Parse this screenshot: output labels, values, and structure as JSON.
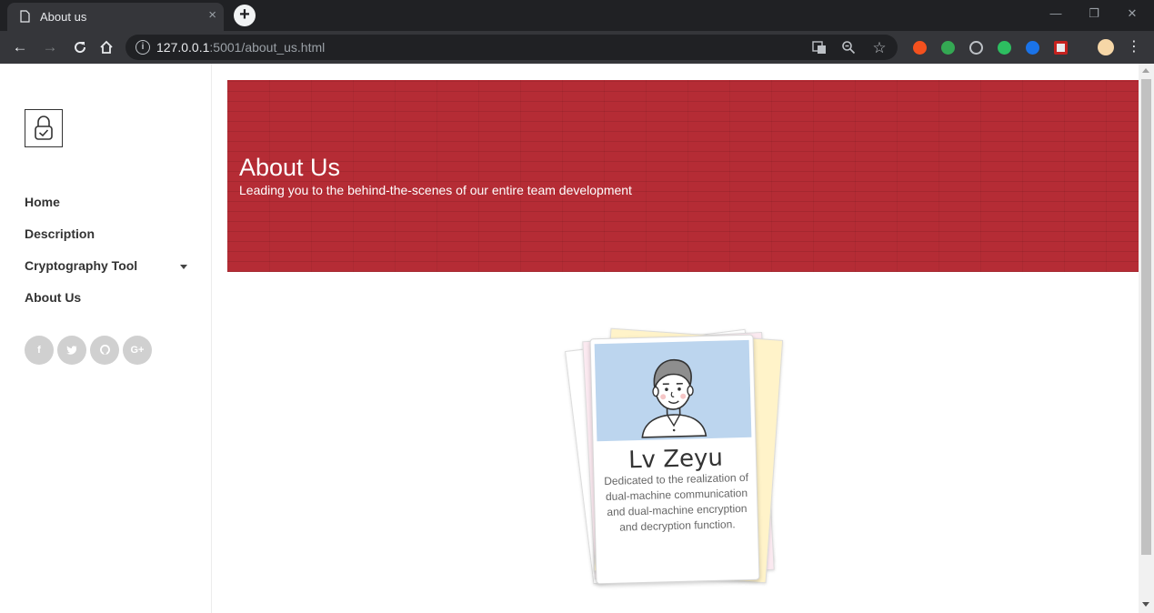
{
  "browser": {
    "tab_title": "About us",
    "tab_close": "×",
    "new_tab": "+",
    "url_host": "127.0.0.1",
    "url_rest": ":5001/about_us.html",
    "info_glyph": "i",
    "window_controls": [
      "—",
      "❐",
      "✕"
    ]
  },
  "sidebar": {
    "logo": "lock-check-logo",
    "nav": [
      {
        "label": "Home"
      },
      {
        "label": "Description"
      },
      {
        "label": "Cryptography Tool",
        "has_dropdown": true
      },
      {
        "label": "About Us"
      }
    ],
    "social": [
      {
        "icon": "facebook-icon",
        "glyph": "f"
      },
      {
        "icon": "twitter-icon",
        "glyph": "t"
      },
      {
        "icon": "github-icon",
        "glyph": "o"
      },
      {
        "icon": "google-plus-icon",
        "glyph": "G+"
      }
    ]
  },
  "hero": {
    "title": "About Us",
    "subtitle": "Leading you to the behind-the-scenes of our entire team development",
    "background_color": "#b52c35"
  },
  "team_card": {
    "name": "Lv Zeyu",
    "bio": "Dedicated to the realization of dual-machine communication and dual-machine encryption and decryption function.",
    "avatar": "male-avatar"
  },
  "colors": {
    "chrome_dark": "#202124",
    "chrome_toolbar": "#35363a",
    "accent_red": "#b52c35",
    "avatar_bg": "#bcd5ee"
  }
}
